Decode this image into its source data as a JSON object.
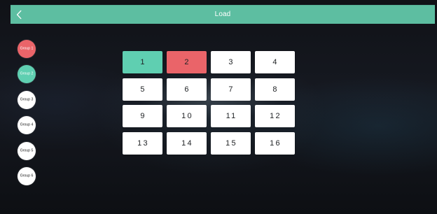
{
  "header": {
    "title": "Load"
  },
  "groups": [
    {
      "label": "Group 1",
      "state": "red"
    },
    {
      "label": "Group 2",
      "state": "green"
    },
    {
      "label": "Group 3",
      "state": "idle"
    },
    {
      "label": "Group 4",
      "state": "idle"
    },
    {
      "label": "Group 5",
      "state": "idle"
    },
    {
      "label": "Group 6",
      "state": "idle"
    }
  ],
  "tiles": [
    {
      "label": "1",
      "state": "green"
    },
    {
      "label": "2",
      "state": "red"
    },
    {
      "label": "3",
      "state": "idle"
    },
    {
      "label": "4",
      "state": "idle"
    },
    {
      "label": "5",
      "state": "idle"
    },
    {
      "label": "6",
      "state": "idle"
    },
    {
      "label": "7",
      "state": "idle"
    },
    {
      "label": "8",
      "state": "idle"
    },
    {
      "label": "9",
      "state": "idle"
    },
    {
      "label": "10",
      "state": "idle"
    },
    {
      "label": "11",
      "state": "idle"
    },
    {
      "label": "12",
      "state": "idle"
    },
    {
      "label": "13",
      "state": "idle"
    },
    {
      "label": "14",
      "state": "idle"
    },
    {
      "label": "15",
      "state": "idle"
    },
    {
      "label": "16",
      "state": "idle"
    }
  ],
  "colors": {
    "accent": "#5dbea1",
    "selected_green": "#5fcfb1",
    "selected_red": "#ea6469",
    "tile_idle": "#ffffff",
    "background": "#121317"
  },
  "icons": {
    "back": "chevron-left-icon"
  }
}
